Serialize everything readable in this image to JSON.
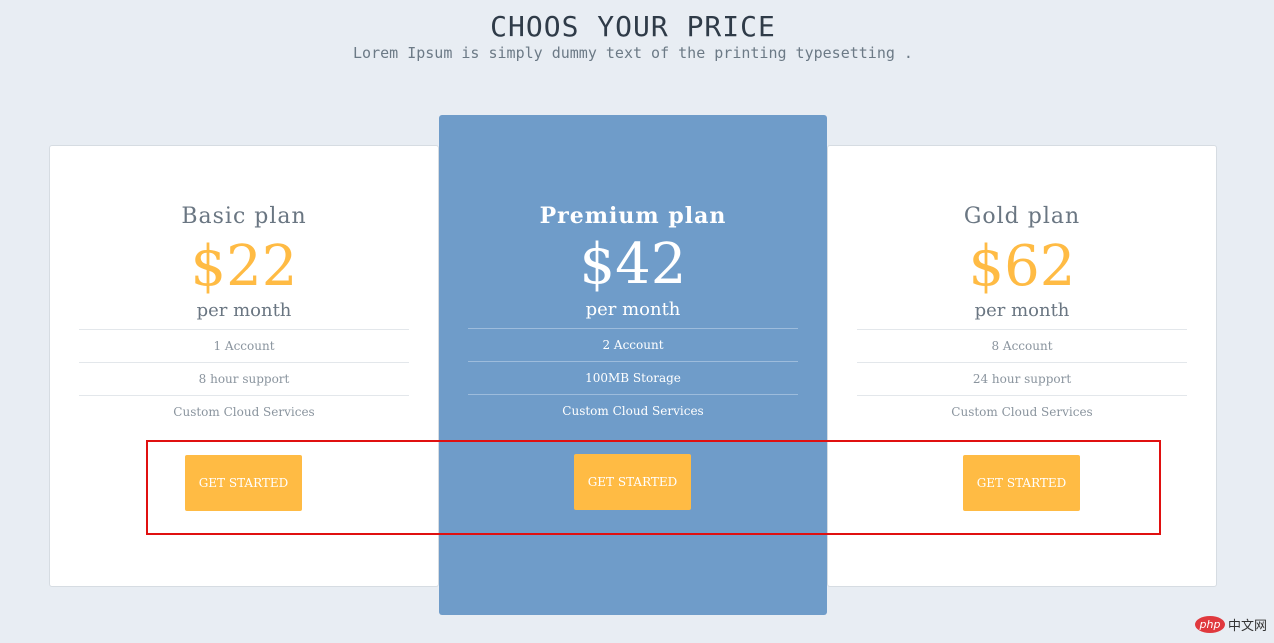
{
  "header": {
    "title": "CHOOS YOUR PRICE",
    "subtitle": "Lorem Ipsum is simply dummy text of the printing typesetting ."
  },
  "plans": [
    {
      "name": "Basic plan",
      "price": "$22",
      "period": "per month",
      "features": [
        "1 Account",
        "8 hour support",
        "Custom Cloud Services"
      ],
      "cta_label": "GET STARTED"
    },
    {
      "name": "Premium plan",
      "price": "$42",
      "period": "per month",
      "features": [
        "2 Account",
        "100MB Storage",
        "Custom Cloud Services"
      ],
      "cta_label": "GET STARTED"
    },
    {
      "name": "Gold plan",
      "price": "$62",
      "period": "per month",
      "features": [
        "8 Account",
        "24 hour support",
        "Custom Cloud Services"
      ],
      "cta_label": "GET STARTED"
    }
  ],
  "watermark": {
    "badge": "php",
    "text": "中文网"
  },
  "colors": {
    "background": "#e8edf3",
    "featured_card": "#6f9cc9",
    "accent": "#ffbb44",
    "highlight_border": "#e01010"
  }
}
